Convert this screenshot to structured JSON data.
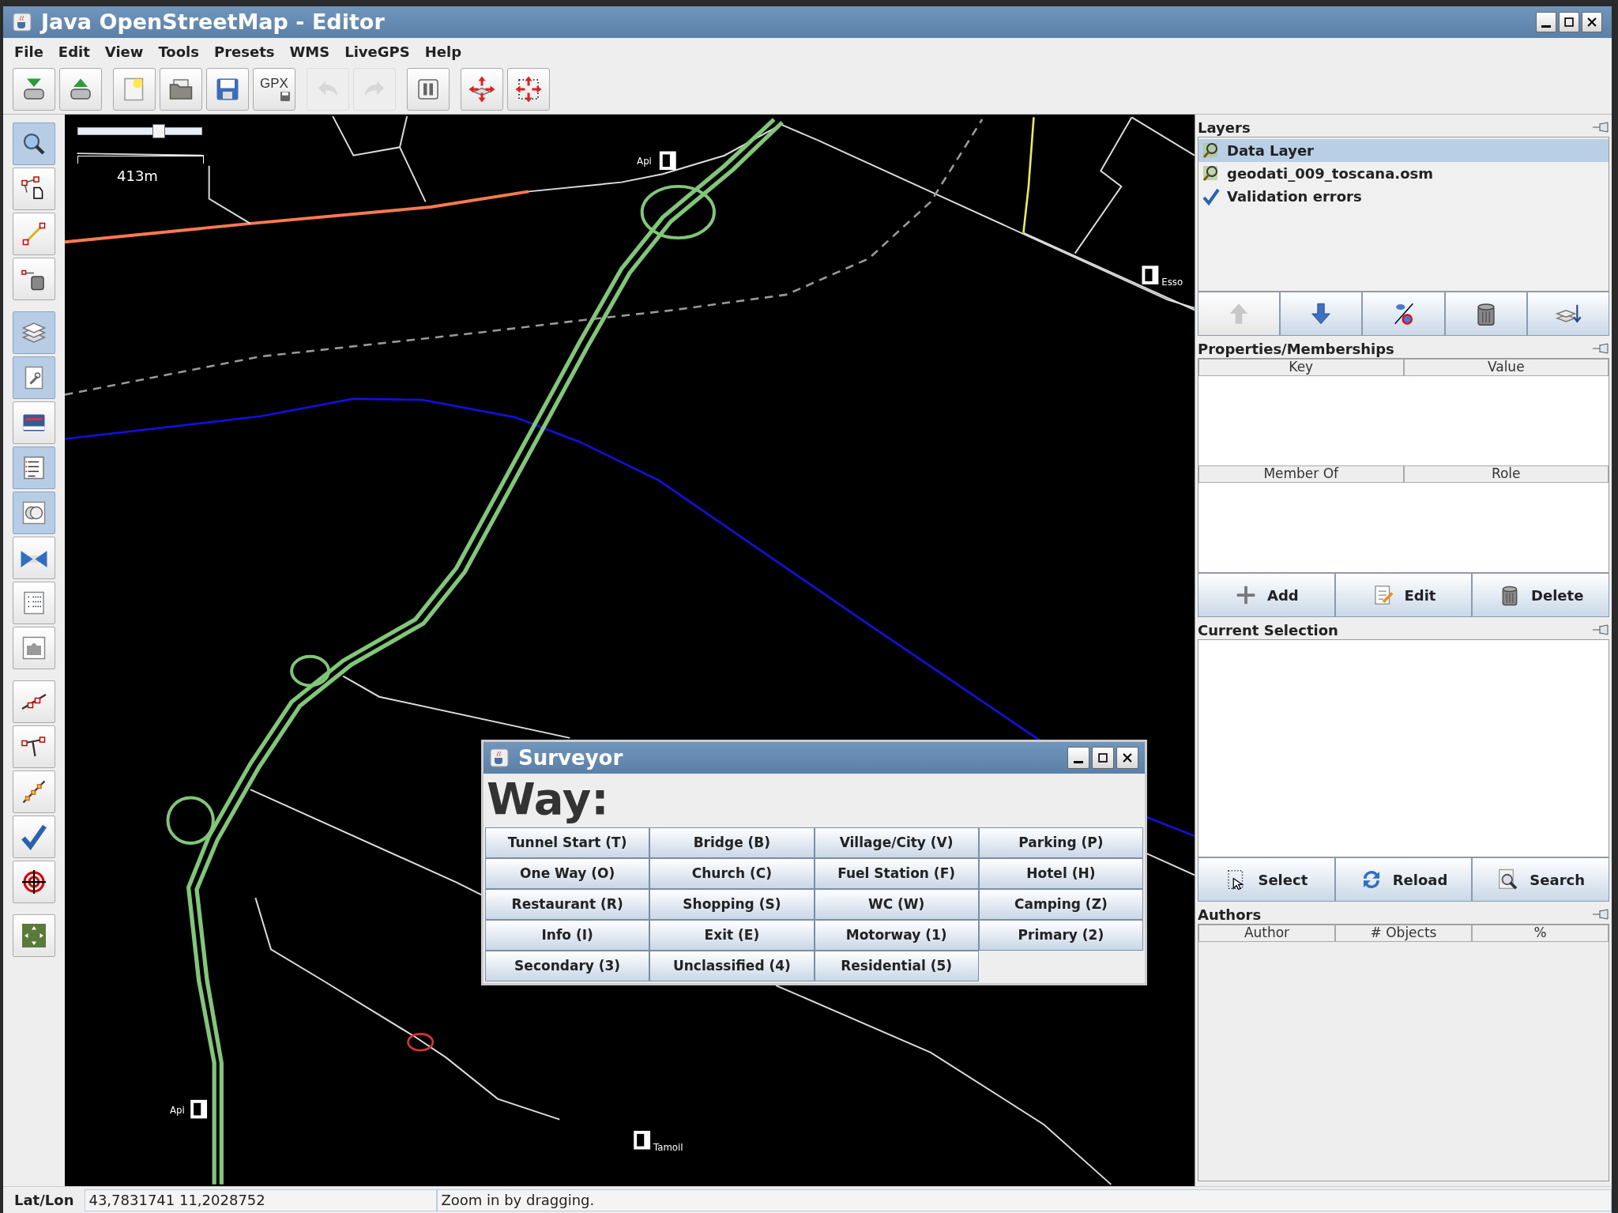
{
  "window": {
    "title": "Java OpenStreetMap - Editor"
  },
  "menu": [
    {
      "label": "File"
    },
    {
      "label": "Edit"
    },
    {
      "label": "View"
    },
    {
      "label": "Tools"
    },
    {
      "label": "Presets"
    },
    {
      "label": "WMS"
    },
    {
      "label": "LiveGPS"
    },
    {
      "label": "Help"
    }
  ],
  "toolbar": [
    [
      {
        "kind": "download",
        "disabled": false
      },
      {
        "kind": "upload",
        "disabled": false
      }
    ],
    [
      {
        "kind": "new",
        "disabled": false
      },
      {
        "kind": "open",
        "disabled": false
      },
      {
        "kind": "save",
        "disabled": false
      },
      {
        "kind": "gpx",
        "label": "GPX",
        "disabled": false
      }
    ],
    [
      {
        "kind": "undo",
        "disabled": true
      },
      {
        "kind": "redo",
        "disabled": true
      }
    ],
    [
      {
        "kind": "preferences",
        "disabled": false
      }
    ],
    [
      {
        "kind": "zoom-data",
        "disabled": false
      },
      {
        "kind": "zoom-selection",
        "disabled": false
      }
    ]
  ],
  "left_toolbar": [
    [
      {
        "kind": "zoom",
        "selected": true
      },
      {
        "kind": "select",
        "selected": false
      },
      {
        "kind": "draw",
        "selected": false
      },
      {
        "kind": "delete",
        "selected": false
      }
    ],
    [
      {
        "kind": "layers",
        "selected": true
      },
      {
        "kind": "properties",
        "selected": true
      },
      {
        "kind": "history",
        "selected": false
      },
      {
        "kind": "selection-list",
        "selected": true
      },
      {
        "kind": "conflict",
        "selected": true
      },
      {
        "kind": "merge",
        "selected": false
      },
      {
        "kind": "commands",
        "selected": false
      },
      {
        "kind": "plugins",
        "selected": false
      }
    ],
    [
      {
        "kind": "align",
        "selected": false
      },
      {
        "kind": "branch",
        "selected": false
      },
      {
        "kind": "chain",
        "selected": false
      },
      {
        "kind": "validate",
        "selected": false
      },
      {
        "kind": "crosshair",
        "selected": false
      }
    ],
    [
      {
        "kind": "tile",
        "selected": false
      }
    ]
  ],
  "map": {
    "zoom_slider": {
      "level": 0.66
    },
    "scale": "413m",
    "labels": [
      {
        "text": "Api"
      },
      {
        "text": "Esso"
      },
      {
        "text": "Api"
      },
      {
        "text": "Tamoil"
      }
    ]
  },
  "surveyor": {
    "title": "Surveyor",
    "heading": "Way:",
    "buttons": [
      "Tunnel Start (T)",
      "Bridge (B)",
      "Village/City (V)",
      "Parking (P)",
      "One Way (O)",
      "Church (C)",
      "Fuel Station (F)",
      "Hotel (H)",
      "Restaurant (R)",
      "Shopping (S)",
      "WC (W)",
      "Camping (Z)",
      "Info (I)",
      "Exit (E)",
      "Motorway (1)",
      "Primary (2)",
      "Secondary (3)",
      "Unclassified (4)",
      "Residential (5)"
    ]
  },
  "layers": {
    "title": "Layers",
    "items": [
      {
        "label": "Data Layer",
        "kind": "data",
        "selected": true
      },
      {
        "label": "geodati_009_toscana.osm",
        "kind": "data",
        "selected": false
      },
      {
        "label": "Validation errors",
        "kind": "validation",
        "selected": false
      }
    ],
    "buttons": [
      {
        "kind": "up",
        "disabled": true
      },
      {
        "kind": "down",
        "disabled": false
      },
      {
        "kind": "visibility",
        "disabled": false
      },
      {
        "kind": "trash",
        "disabled": false
      },
      {
        "kind": "merge-layers",
        "disabled": false
      }
    ]
  },
  "properties": {
    "title": "Properties/Memberships",
    "columns": [
      "Key",
      "Value"
    ],
    "member_columns": [
      "Member Of",
      "Role"
    ],
    "buttons": [
      {
        "kind": "add",
        "label": "Add"
      },
      {
        "kind": "edit",
        "label": "Edit"
      },
      {
        "kind": "trash",
        "label": "Delete"
      }
    ]
  },
  "current_selection": {
    "title": "Current Selection",
    "buttons": [
      {
        "kind": "select-area",
        "label": "Select"
      },
      {
        "kind": "reload",
        "label": "Reload"
      },
      {
        "kind": "search",
        "label": "Search"
      }
    ]
  },
  "authors": {
    "title": "Authors",
    "columns": [
      "Author",
      "# Objects",
      "%"
    ]
  },
  "status_bar": {
    "label": "Lat/Lon",
    "coordinates": "43,7831741 11,2028752",
    "message": "Zoom in by dragging."
  }
}
